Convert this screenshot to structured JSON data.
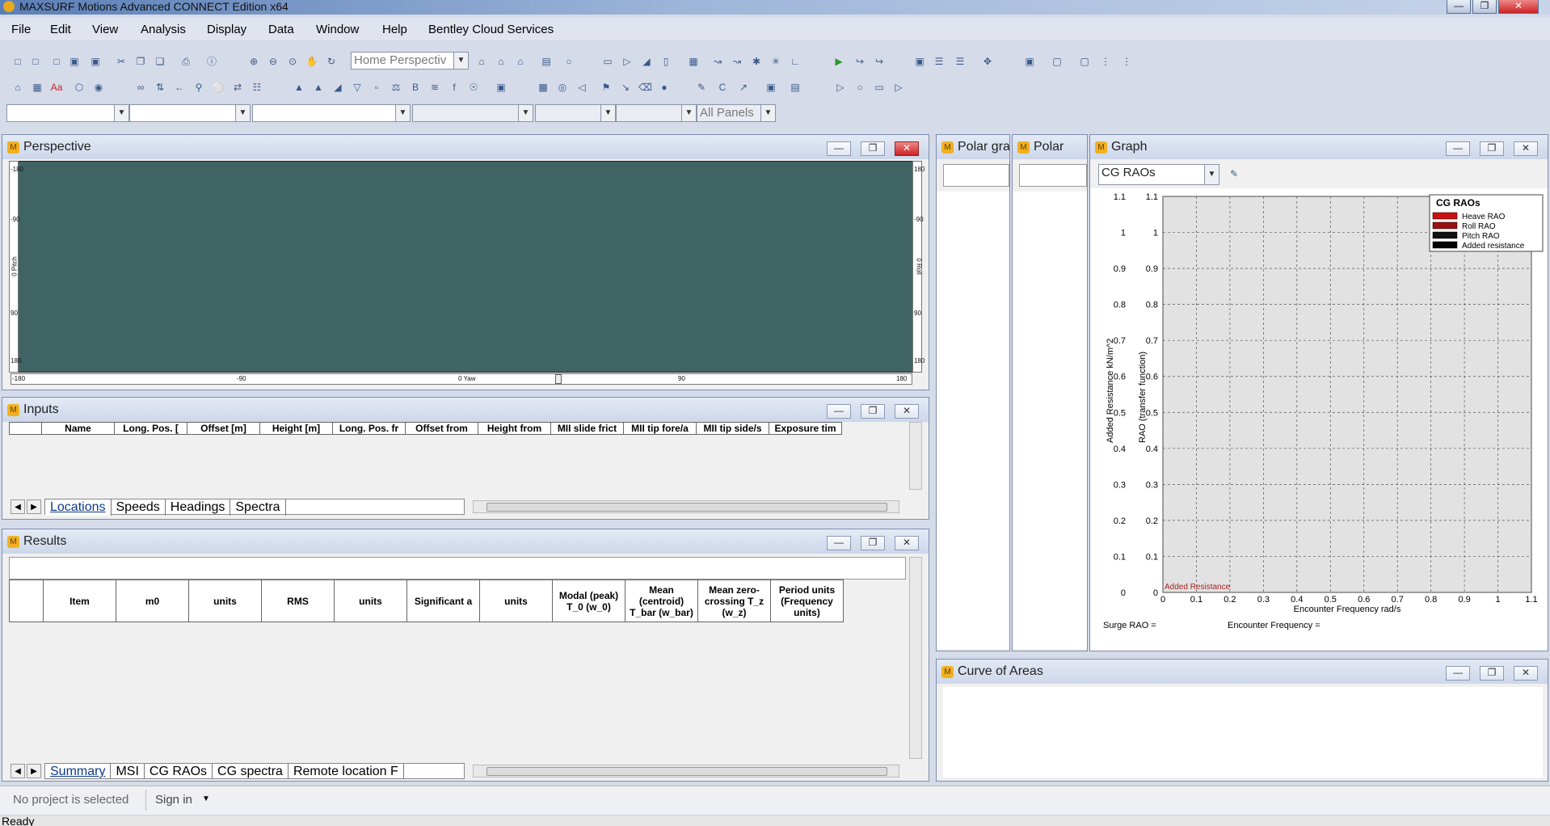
{
  "window": {
    "title": "MAXSURF Motions Advanced CONNECT Edition x64"
  },
  "menu": [
    "File",
    "Edit",
    "View",
    "Analysis",
    "Display",
    "Data",
    "Window",
    "Help",
    "Bentley Cloud Services"
  ],
  "toolbar": {
    "view_combo": "Home Perspectiv",
    "panels_combo": "All Panels"
  },
  "perspective": {
    "title": "Perspective",
    "bg_color": "#406364",
    "axis_x_ticks": [
      "-180",
      "-90",
      "0 Yaw",
      "90",
      "180"
    ],
    "axis_y_left": [
      "-180",
      "-90",
      "0 Pitch",
      "90",
      "180"
    ],
    "axis_y_right": [
      "180",
      "-90",
      "0 Roll",
      "90",
      "180"
    ]
  },
  "inputs": {
    "title": "Inputs",
    "columns": [
      "",
      "Name",
      "Long. Pos. [",
      "Offset [m]",
      "Height [m]",
      "Long. Pos. fr",
      "Offset from",
      "Height from",
      "MII slide frict",
      "MII tip fore/a",
      "MII tip side/s",
      "Exposure tim"
    ],
    "tabs": [
      "Locations",
      "Speeds",
      "Headings",
      "Spectra"
    ]
  },
  "results": {
    "title": "Results",
    "columns": [
      "",
      "Item",
      "m0",
      "units",
      "RMS",
      "units",
      "Significant a",
      "units",
      "Modal (peak) T_0    (w_0)",
      "Mean (centroid) T_bar (w_bar)",
      "Mean zero-crossing T_z    (w_z)",
      "Period units (Frequency units)"
    ],
    "tabs": [
      "Summary",
      "MSI",
      "CG RAOs",
      "CG spectra",
      "Remote location F"
    ]
  },
  "polar1": {
    "title": "Polar gra"
  },
  "polar2": {
    "title": "Polar"
  },
  "graph": {
    "title": "Graph",
    "combo": "CG RAOs",
    "legend_title": "CG RAOs",
    "legend": [
      {
        "name": "Heave RAO",
        "color": "#cc1111"
      },
      {
        "name": "Roll RAO",
        "color": "#991111"
      },
      {
        "name": "Pitch RAO",
        "color": "#111111"
      },
      {
        "name": "Added resistance",
        "color": "#000000"
      }
    ],
    "y_ticks": [
      "1.1",
      "1",
      "0.9",
      "0.8",
      "0.7",
      "0.6",
      "0.5",
      "0.4",
      "0.3",
      "0.2",
      "0.1",
      "0"
    ],
    "x_ticks": [
      "0",
      "0.1",
      "0.2",
      "0.3",
      "0.4",
      "0.5",
      "0.6",
      "0.7",
      "0.8",
      "0.9",
      "1",
      "1.1"
    ],
    "ylabel_outer": "Added Resistance  kN/m^2",
    "ylabel_inner": "RAO (transfer function)",
    "xlabel": "Encounter Frequency  rad/s",
    "overlap_text": "Added Resistance",
    "footer_left": "Surge RAO =",
    "footer_right": "Encounter Frequency ="
  },
  "curve": {
    "title": "Curve of Areas"
  },
  "bottom": {
    "project": "No project is selected",
    "signin": "Sign in"
  },
  "status": "Ready"
}
